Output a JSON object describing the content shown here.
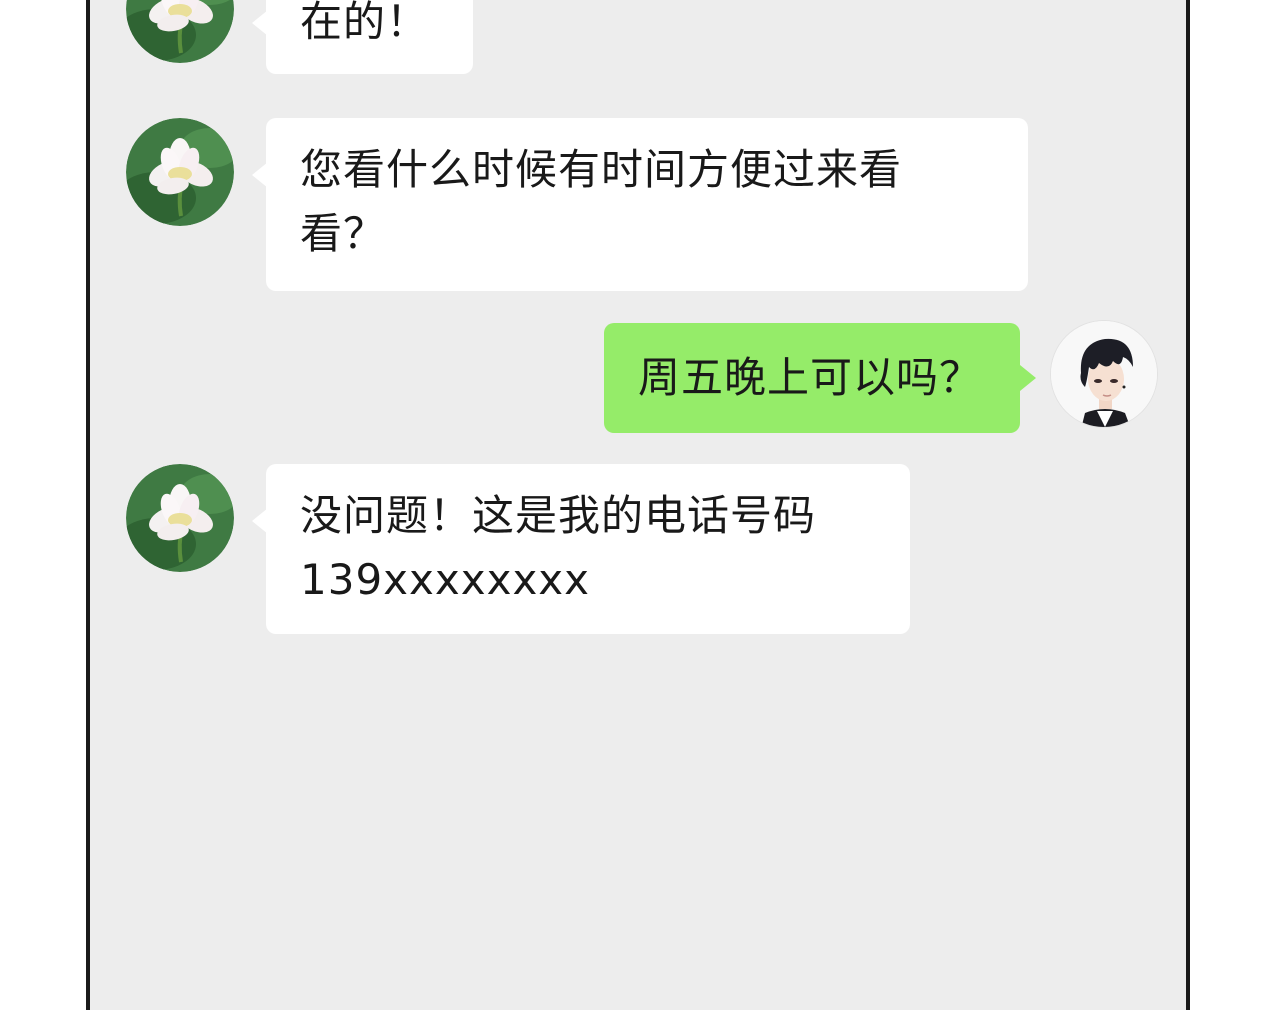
{
  "chat": {
    "messages": [
      {
        "sender": "contact",
        "avatar": "lotus-avatar",
        "lines": [
          "在的！"
        ]
      },
      {
        "sender": "contact",
        "avatar": "lotus-avatar",
        "lines": [
          "您看什么时候有时间方便过来看",
          "看？"
        ]
      },
      {
        "sender": "me",
        "avatar": "man-avatar",
        "lines": [
          "周五晚上可以吗？"
        ]
      },
      {
        "sender": "contact",
        "avatar": "lotus-avatar",
        "lines": [
          "没问题！这是我的电话号码",
          "139xxxxxxxx"
        ]
      }
    ]
  },
  "colors": {
    "chat_background": "#ededed",
    "incoming_bubble": "#ffffff",
    "outgoing_bubble": "#95ec69",
    "frame_border": "#1a1a1a"
  }
}
